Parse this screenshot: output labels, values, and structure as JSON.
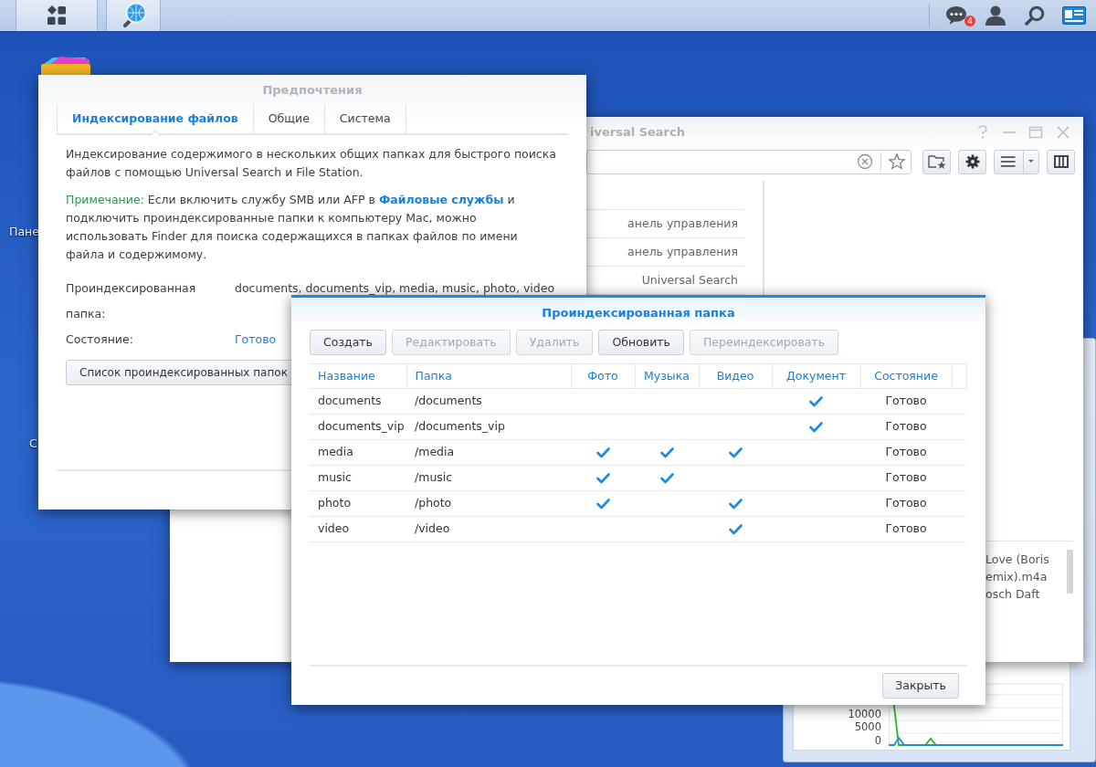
{
  "taskbar": {
    "notification_count": "4"
  },
  "desktop_icons": [
    {
      "label": "Пане"
    },
    {
      "label": "С"
    }
  ],
  "widget": {
    "y_labels": [
      "10000",
      "5000",
      "0"
    ]
  },
  "search_window": {
    "title": "iversal Search",
    "results": [
      {
        "source": "анель управления"
      },
      {
        "source": "анель управления"
      },
      {
        "source": "Universal Search"
      }
    ],
    "preview_lines": [
      "Love (Boris",
      "emix).m4a",
      "osch Daft"
    ]
  },
  "preferences": {
    "title": "Предпочтения",
    "tabs": [
      {
        "label": "Индексирование файлов",
        "selected": true
      },
      {
        "label": "Общие",
        "selected": false
      },
      {
        "label": "Система",
        "selected": false
      }
    ],
    "description": "Индексирование содержимого в нескольких общих папках для быстрого поиска файлов с помощью Universal Search и File Station.",
    "note": {
      "label": "Примечание:",
      "text_before": "Если включить службу SMB или AFP в",
      "link": "Файловые службы",
      "text_after": "и подключить проиндексированные папки к компьютеру Mac, можно использовать Finder для поиска содержащихся в папках файлов по имени файла и содержимому."
    },
    "fields": [
      {
        "label": "Проиндексированная папка:",
        "value": "documents, documents_vip, media, music, photo, video",
        "kind": "text"
      },
      {
        "label": "Состояние:",
        "value": "Готово",
        "kind": "status"
      }
    ],
    "list_button": "Список проиндексированных папок"
  },
  "indexed_window": {
    "title": "Проиндексированная папка",
    "toolbar": [
      {
        "label": "Создать",
        "disabled": false
      },
      {
        "label": "Редактировать",
        "disabled": true
      },
      {
        "label": "Удалить",
        "disabled": true
      },
      {
        "label": "Обновить",
        "disabled": false
      },
      {
        "label": "Переиндексировать",
        "disabled": true
      }
    ],
    "table": {
      "columns": [
        "Название",
        "Папка",
        "Фото",
        "Музыка",
        "Видео",
        "Документ",
        "Состояние"
      ],
      "rows": [
        {
          "name": "documents",
          "folder": "/documents",
          "photo": false,
          "music": false,
          "video": false,
          "document": true,
          "status": "Готово"
        },
        {
          "name": "documents_vip",
          "folder": "/documents_vip",
          "photo": false,
          "music": false,
          "video": false,
          "document": true,
          "status": "Готово"
        },
        {
          "name": "media",
          "folder": "/media",
          "photo": true,
          "music": true,
          "video": true,
          "document": false,
          "status": "Готово"
        },
        {
          "name": "music",
          "folder": "/music",
          "photo": true,
          "music": true,
          "video": false,
          "document": false,
          "status": "Готово"
        },
        {
          "name": "photo",
          "folder": "/photo",
          "photo": true,
          "music": false,
          "video": true,
          "document": false,
          "status": "Готово"
        },
        {
          "name": "video",
          "folder": "/video",
          "photo": false,
          "music": false,
          "video": true,
          "document": false,
          "status": "Готово"
        }
      ]
    },
    "close_button": "Закрыть"
  }
}
